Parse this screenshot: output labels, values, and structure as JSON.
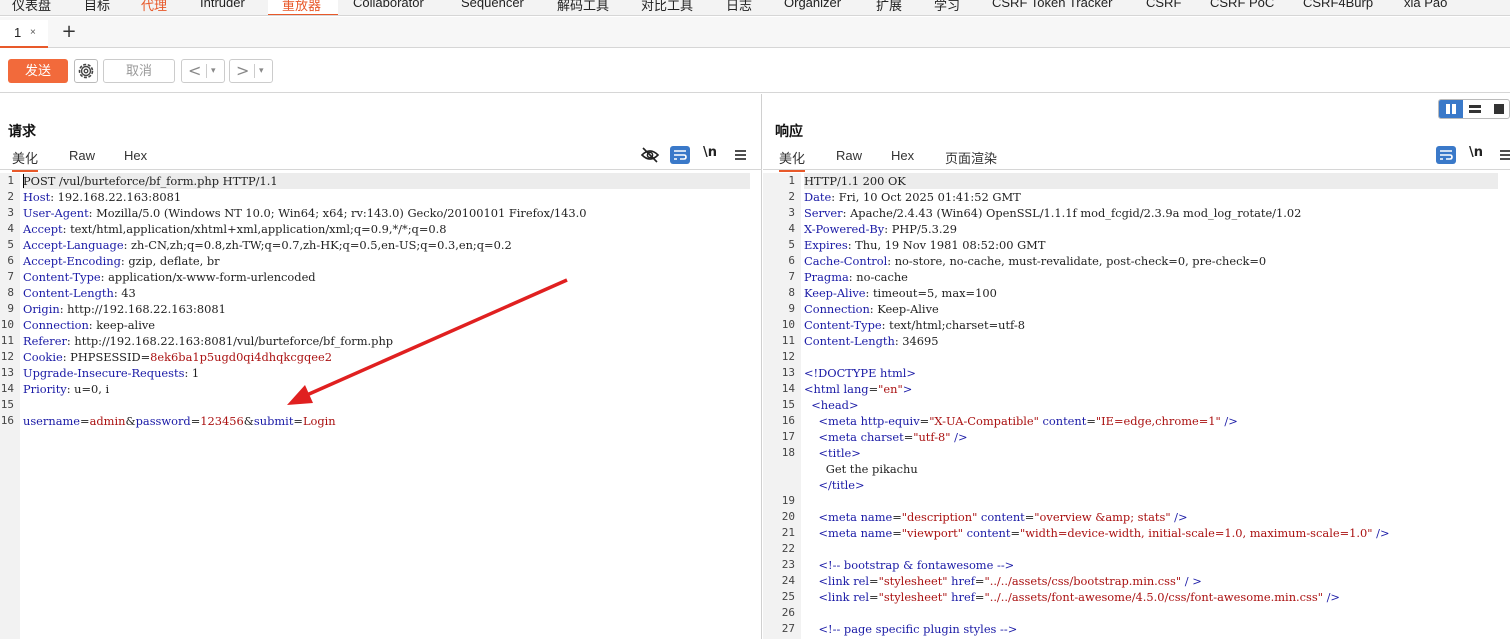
{
  "top_menu": {
    "items": [
      "仪表盘",
      "目标",
      "代理",
      "Intruder",
      "重放器",
      "Collaborator",
      "Sequencer",
      "解码工具",
      "对比工具",
      "日志",
      "Organizer",
      "扩展",
      "学习",
      "CSRF Token Tracker",
      "CSRF",
      "CSRF PoC",
      "CSRF4Burp",
      "xia Pao"
    ],
    "active_index": 4,
    "accent_color": "#e8592a"
  },
  "tabs": {
    "items": [
      {
        "label": "1",
        "close": "×"
      }
    ],
    "add": "+"
  },
  "toolbar": {
    "send": "发送",
    "cancel": "取消",
    "prev": "<",
    "next": ">",
    "dropdown": "▾"
  },
  "request": {
    "title": "请求",
    "tabs": [
      "美化",
      "Raw",
      "Hex"
    ],
    "newline_label": "\\n",
    "lines": [
      [
        [
          "POST /vul/burteforce/bf_form.php HTTP/1.1",
          "v"
        ]
      ],
      [
        [
          "Host",
          "k"
        ],
        [
          ": 192.168.22.163:8081",
          "v"
        ]
      ],
      [
        [
          "User-Agent",
          "k"
        ],
        [
          ": Mozilla/5.0 (Windows NT 10.0; Win64; x64; rv:143.0) Gecko/20100101 Firefox/143.0",
          "v"
        ]
      ],
      [
        [
          "Accept",
          "k"
        ],
        [
          ": text/html,application/xhtml+xml,application/xml;q=0.9,*/*;q=0.8",
          "v"
        ]
      ],
      [
        [
          "Accept-Language",
          "k"
        ],
        [
          ": zh-CN,zh;q=0.8,zh-TW;q=0.7,zh-HK;q=0.5,en-US;q=0.3,en;q=0.2",
          "v"
        ]
      ],
      [
        [
          "Accept-Encoding",
          "k"
        ],
        [
          ": gzip, deflate, br",
          "v"
        ]
      ],
      [
        [
          "Content-Type",
          "k"
        ],
        [
          ": application/x-www-form-urlencoded",
          "v"
        ]
      ],
      [
        [
          "Content-Length",
          "k"
        ],
        [
          ": 43",
          "v"
        ]
      ],
      [
        [
          "Origin",
          "k"
        ],
        [
          ": http://192.168.22.163:8081",
          "v"
        ]
      ],
      [
        [
          "Connection",
          "k"
        ],
        [
          ": keep-alive",
          "v"
        ]
      ],
      [
        [
          "Referer",
          "k"
        ],
        [
          ": http://192.168.22.163:8081/vul/burteforce/bf_form.php",
          "v"
        ]
      ],
      [
        [
          "Cookie",
          "k"
        ],
        [
          ": PHPSESSID=",
          "v"
        ],
        [
          "8ek6ba1p5ugd0qi4dhqkcgqee2",
          "s"
        ]
      ],
      [
        [
          "Upgrade-Insecure-Requests",
          "k"
        ],
        [
          ": 1",
          "v"
        ]
      ],
      [
        [
          "Priority",
          "k"
        ],
        [
          ": u=0, i",
          "v"
        ]
      ],
      [
        [
          "",
          "v"
        ]
      ],
      [
        [
          "username",
          "k"
        ],
        [
          "=",
          "v"
        ],
        [
          "admin",
          "s"
        ],
        [
          "&",
          "v"
        ],
        [
          "password",
          "k"
        ],
        [
          "=",
          "v"
        ],
        [
          "123456",
          "s"
        ],
        [
          "&",
          "v"
        ],
        [
          "submit",
          "k"
        ],
        [
          "=",
          "v"
        ],
        [
          "Login",
          "s"
        ]
      ]
    ]
  },
  "response": {
    "title": "响应",
    "tabs": [
      "美化",
      "Raw",
      "Hex",
      "页面渲染"
    ],
    "newline_label": "\\n",
    "lines": [
      {
        "n": "1",
        "t": [
          [
            "HTTP/1.1 200 OK",
            "v"
          ]
        ]
      },
      {
        "n": "2",
        "t": [
          [
            "Date",
            "k"
          ],
          [
            ": Fri, 10 Oct 2025 01:41:52 GMT",
            "v"
          ]
        ]
      },
      {
        "n": "3",
        "t": [
          [
            "Server",
            "k"
          ],
          [
            ": Apache/2.4.43 (Win64) OpenSSL/1.1.1f mod_fcgid/2.3.9a mod_log_rotate/1.02",
            "v"
          ]
        ]
      },
      {
        "n": "4",
        "t": [
          [
            "X-Powered-By",
            "k"
          ],
          [
            ": PHP/5.3.29",
            "v"
          ]
        ]
      },
      {
        "n": "5",
        "t": [
          [
            "Expires",
            "k"
          ],
          [
            ": Thu, 19 Nov 1981 08:52:00 GMT",
            "v"
          ]
        ]
      },
      {
        "n": "6",
        "t": [
          [
            "Cache-Control",
            "k"
          ],
          [
            ": no-store, no-cache, must-revalidate, post-check=0, pre-check=0",
            "v"
          ]
        ]
      },
      {
        "n": "7",
        "t": [
          [
            "Pragma",
            "k"
          ],
          [
            ": no-cache",
            "v"
          ]
        ]
      },
      {
        "n": "8",
        "t": [
          [
            "Keep-Alive",
            "k"
          ],
          [
            ": timeout=5, max=100",
            "v"
          ]
        ]
      },
      {
        "n": "9",
        "t": [
          [
            "Connection",
            "k"
          ],
          [
            ": Keep-Alive",
            "v"
          ]
        ]
      },
      {
        "n": "10",
        "t": [
          [
            "Content-Type",
            "k"
          ],
          [
            ": text/html;charset=utf-8",
            "v"
          ]
        ]
      },
      {
        "n": "11",
        "t": [
          [
            "Content-Length",
            "k"
          ],
          [
            ": 34695",
            "v"
          ]
        ]
      },
      {
        "n": "12",
        "t": [
          [
            "",
            "v"
          ]
        ]
      },
      {
        "n": "13",
        "t": [
          [
            "<!DOCTYPE html>",
            "t"
          ]
        ]
      },
      {
        "n": "14",
        "t": [
          [
            "<html ",
            "t"
          ],
          [
            "lang",
            "t"
          ],
          [
            "=",
            "v"
          ],
          [
            "\"en\"",
            "a"
          ],
          [
            ">",
            "t"
          ]
        ]
      },
      {
        "n": "15",
        "t": [
          [
            "  <head>",
            "t"
          ]
        ]
      },
      {
        "n": "16",
        "t": [
          [
            "    <meta ",
            "t"
          ],
          [
            "http-equiv",
            "t"
          ],
          [
            "=",
            "v"
          ],
          [
            "\"X-UA-Compatible\"",
            "a"
          ],
          [
            " content",
            "t"
          ],
          [
            "=",
            "v"
          ],
          [
            "\"IE=edge,chrome=1\"",
            "a"
          ],
          [
            " />",
            "t"
          ]
        ]
      },
      {
        "n": "17",
        "t": [
          [
            "    <meta ",
            "t"
          ],
          [
            "charset",
            "t"
          ],
          [
            "=",
            "v"
          ],
          [
            "\"utf-8\"",
            "a"
          ],
          [
            " />",
            "t"
          ]
        ]
      },
      {
        "n": "18",
        "t": [
          [
            "    <title>",
            "t"
          ]
        ]
      },
      {
        "n": "",
        "t": [
          [
            "      Get the pikachu",
            "v"
          ]
        ]
      },
      {
        "n": "",
        "t": [
          [
            "    </title>",
            "t"
          ]
        ]
      },
      {
        "n": "19",
        "t": [
          [
            "",
            "v"
          ]
        ]
      },
      {
        "n": "20",
        "t": [
          [
            "    <meta ",
            "t"
          ],
          [
            "name",
            "t"
          ],
          [
            "=",
            "v"
          ],
          [
            "\"description\"",
            "a"
          ],
          [
            " content",
            "t"
          ],
          [
            "=",
            "v"
          ],
          [
            "\"overview &amp; stats\"",
            "a"
          ],
          [
            " />",
            "t"
          ]
        ]
      },
      {
        "n": "21",
        "t": [
          [
            "    <meta ",
            "t"
          ],
          [
            "name",
            "t"
          ],
          [
            "=",
            "v"
          ],
          [
            "\"viewport\"",
            "a"
          ],
          [
            " content",
            "t"
          ],
          [
            "=",
            "v"
          ],
          [
            "\"width=device-width, initial-scale=1.0, maximum-scale=1.0\"",
            "a"
          ],
          [
            " />",
            "t"
          ]
        ]
      },
      {
        "n": "22",
        "t": [
          [
            "",
            "v"
          ]
        ]
      },
      {
        "n": "23",
        "t": [
          [
            "    <!-- bootstrap & fontawesome -->",
            "cm"
          ]
        ]
      },
      {
        "n": "24",
        "t": [
          [
            "    <link ",
            "t"
          ],
          [
            "rel",
            "t"
          ],
          [
            "=",
            "v"
          ],
          [
            "\"stylesheet\"",
            "a"
          ],
          [
            " href",
            "t"
          ],
          [
            "=",
            "v"
          ],
          [
            "\"../../assets/css/bootstrap.min.css\"",
            "a"
          ],
          [
            " / >",
            "t"
          ]
        ]
      },
      {
        "n": "25",
        "t": [
          [
            "    <link ",
            "t"
          ],
          [
            "rel",
            "t"
          ],
          [
            "=",
            "v"
          ],
          [
            "\"stylesheet\"",
            "a"
          ],
          [
            " href",
            "t"
          ],
          [
            "=",
            "v"
          ],
          [
            "\"../../assets/font-awesome/4.5.0/css/font-awesome.min.css\"",
            "a"
          ],
          [
            " />",
            "t"
          ]
        ]
      },
      {
        "n": "26",
        "t": [
          [
            "",
            "v"
          ]
        ]
      },
      {
        "n": "27",
        "t": [
          [
            "    <!-- page specific plugin styles -->",
            "cm"
          ]
        ]
      }
    ]
  },
  "annotation": {
    "color": "#e02020"
  }
}
